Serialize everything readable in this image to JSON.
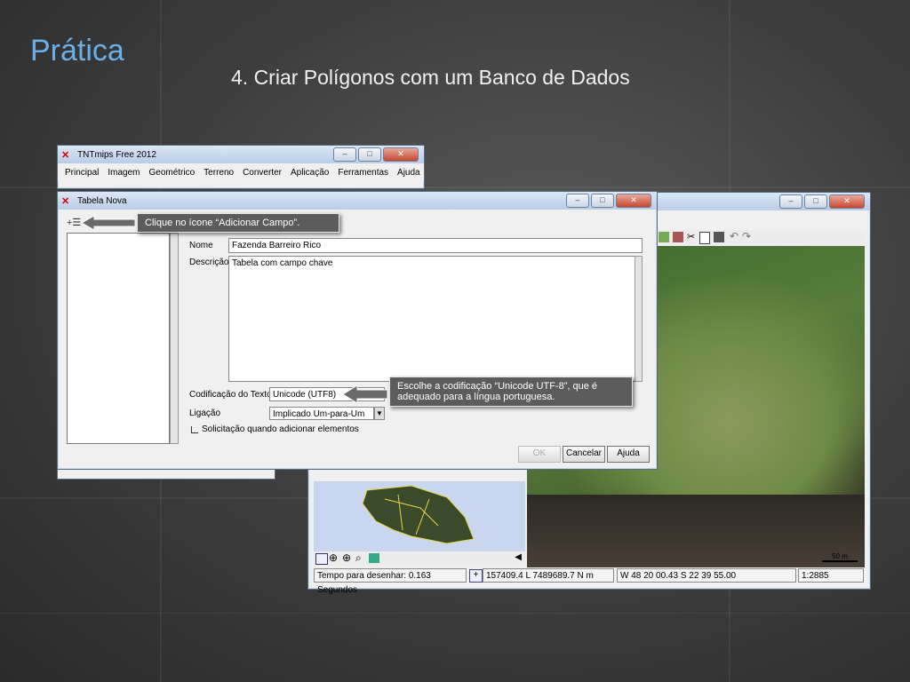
{
  "slide": {
    "title": "Prática",
    "subtitle": "4. Criar Polígonos com um Banco de Dados"
  },
  "main_window": {
    "title": "TNTmips Free 2012",
    "menu": [
      "Principal",
      "Imagem",
      "Geométrico",
      "Terreno",
      "Converter",
      "Aplicação",
      "Ferramentas",
      "Ajuda"
    ]
  },
  "dialog": {
    "title": "Tabela Nova",
    "name_label": "Nome",
    "name_value": "Fazenda Barreiro Rico",
    "description_label": "Descrição",
    "description_value": "Tabela com campo chave",
    "encoding_label": "Codificação do Texto:",
    "encoding_value": "Unicode (UTF8)",
    "link_label": "Ligação",
    "link_value": "Implicado Um-para-Um",
    "checkbox_label": "Solicitação quando adicionar elementos",
    "buttons": {
      "ok": "OK",
      "cancel": "Cancelar",
      "help": "Ajuda"
    }
  },
  "callouts": {
    "add_field": "Clique no ícone “Adicionar Campo”.",
    "encoding": "Escolhe a codificação “Unicode UTF-8”, que é adequado para a língua portuguesa."
  },
  "map_window": {
    "scale_bar": "50 m",
    "status": {
      "draw_time": "Tempo para desenhar: 0.163 Segundos",
      "coords": "157409.4 L  7489689.7 N m",
      "latlon": "W 48 20 00.43  S 22 39 55.00",
      "scale": "1:2885"
    }
  },
  "colors": {
    "title_blue": "#6ab0e8",
    "callout_bg": "#5c5c5c"
  }
}
